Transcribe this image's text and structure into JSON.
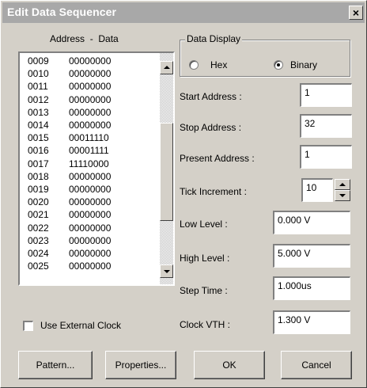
{
  "window": {
    "title": "Edit Data Sequencer",
    "close_glyph": "×"
  },
  "list": {
    "header": "Address  -  Data",
    "rows": [
      {
        "address": "0009",
        "data": "00000000"
      },
      {
        "address": "0010",
        "data": "00000000"
      },
      {
        "address": "0011",
        "data": "00000000"
      },
      {
        "address": "0012",
        "data": "00000000"
      },
      {
        "address": "0013",
        "data": "00000000"
      },
      {
        "address": "0014",
        "data": "00000000"
      },
      {
        "address": "0015",
        "data": "00011110"
      },
      {
        "address": "0016",
        "data": "00001111"
      },
      {
        "address": "0017",
        "data": "11110000"
      },
      {
        "address": "0018",
        "data": "00000000"
      },
      {
        "address": "0019",
        "data": "00000000"
      },
      {
        "address": "0020",
        "data": "00000000"
      },
      {
        "address": "0021",
        "data": "00000000"
      },
      {
        "address": "0022",
        "data": "00000000"
      },
      {
        "address": "0023",
        "data": "00000000"
      },
      {
        "address": "0024",
        "data": "00000000"
      },
      {
        "address": "0025",
        "data": "00000000"
      }
    ]
  },
  "data_display": {
    "legend": "Data Display",
    "hex_label": "Hex",
    "binary_label": "Binary",
    "selected": "Binary"
  },
  "fields": {
    "start_address": {
      "label": "Start Address :",
      "value": "1"
    },
    "stop_address": {
      "label": "Stop Address :",
      "value": "32"
    },
    "present_address": {
      "label": "Present Address :",
      "value": "1"
    },
    "tick_increment": {
      "label": "Tick Increment :",
      "value": "10"
    },
    "low_level": {
      "label": "Low Level :",
      "value": "0.000 V"
    },
    "high_level": {
      "label": "High Level :",
      "value": "5.000 V"
    },
    "step_time": {
      "label": "Step Time :",
      "value": "1.000us"
    },
    "clock_vth": {
      "label": "Clock VTH :",
      "value": "1.300 V"
    }
  },
  "use_external_clock": {
    "label": "Use External Clock",
    "checked": false
  },
  "buttons": {
    "pattern": "Pattern...",
    "properties": "Properties...",
    "ok": "OK",
    "cancel": "Cancel"
  }
}
